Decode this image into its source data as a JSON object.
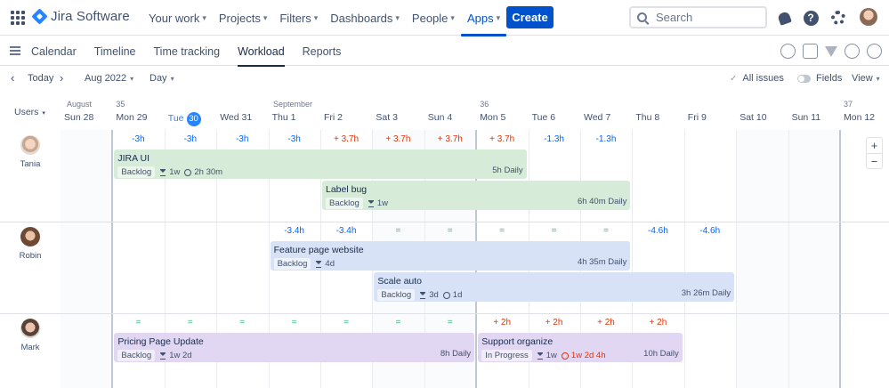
{
  "app": {
    "logo_text": "Jira Software"
  },
  "nav": [
    {
      "label": "Your work",
      "chevron": true,
      "active": false
    },
    {
      "label": "Projects",
      "chevron": true,
      "active": false
    },
    {
      "label": "Filters",
      "chevron": true,
      "active": false
    },
    {
      "label": "Dashboards",
      "chevron": true,
      "active": false
    },
    {
      "label": "People",
      "chevron": true,
      "active": false
    },
    {
      "label": "Apps",
      "chevron": true,
      "active": true
    }
  ],
  "create_label": "Create",
  "search": {
    "placeholder": "Search"
  },
  "tabs": [
    {
      "label": "Calendar",
      "active": false
    },
    {
      "label": "Timeline",
      "active": false
    },
    {
      "label": "Time tracking",
      "active": false
    },
    {
      "label": "Workload",
      "active": true
    },
    {
      "label": "Reports",
      "active": false
    }
  ],
  "toolbar": {
    "today": "Today",
    "month": "Aug 2022",
    "view_mode": "Day",
    "all_issues": "All issues",
    "fields": "Fields",
    "view": "View"
  },
  "calendar": {
    "users_label": "Users",
    "month_labels": {
      "aug": "August",
      "sep": "September"
    },
    "days": [
      {
        "label": "Sun 28",
        "week": "",
        "today": false
      },
      {
        "label": "Mon 29",
        "week": "35",
        "today": false
      },
      {
        "label": "Tue",
        "week": "",
        "today": true,
        "day_num": "30"
      },
      {
        "label": "Wed 31",
        "week": "",
        "today": false
      },
      {
        "label": "Thu 1",
        "week": "",
        "today": false
      },
      {
        "label": "Fri 2",
        "week": "",
        "today": false
      },
      {
        "label": "Sat 3",
        "week": "",
        "today": false
      },
      {
        "label": "Sun 4",
        "week": "",
        "today": false
      },
      {
        "label": "Mon 5",
        "week": "36",
        "today": false
      },
      {
        "label": "Tue 6",
        "week": "",
        "today": false
      },
      {
        "label": "Wed 7",
        "week": "",
        "today": false
      },
      {
        "label": "Thu 8",
        "week": "",
        "today": false
      },
      {
        "label": "Fri 9",
        "week": "",
        "today": false
      },
      {
        "label": "Sat 10",
        "week": "",
        "today": false
      },
      {
        "label": "Sun 11",
        "week": "",
        "today": false
      },
      {
        "label": "Mon 12",
        "week": "37",
        "today": false
      }
    ]
  },
  "users": [
    {
      "name": "Tania",
      "deltas": [
        "-3h",
        "-3h",
        "-3h",
        "-3h",
        "+ 3.7h",
        "+ 3.7h",
        "+ 3.7h",
        "+ 3.7h",
        "-1.3h",
        "-1.3h"
      ],
      "delta_types": [
        "neg",
        "neg",
        "neg",
        "neg",
        "pos",
        "pos",
        "pos",
        "pos",
        "neg",
        "neg"
      ],
      "delta_start": 1,
      "tasks": [
        {
          "title": "JIRA UI",
          "status": "Backlog",
          "estimate": "1w",
          "logged": "2h 30m",
          "daily": "5h Daily",
          "color": "green",
          "start": 1,
          "span": 8,
          "lane": 0
        },
        {
          "title": "Label bug",
          "status": "Backlog",
          "estimate": "1w",
          "logged": "",
          "daily": "6h 40m Daily",
          "color": "green",
          "start": 5,
          "span": 6,
          "lane": 1
        }
      ]
    },
    {
      "name": "Robin",
      "deltas": [
        "-3.4h",
        "-3.4h",
        "=",
        "=",
        "=",
        "=",
        "=",
        "-4.6h",
        "-4.6h"
      ],
      "delta_types": [
        "neg",
        "neg",
        "eq",
        "eq",
        "eq",
        "eq",
        "eq",
        "neg",
        "neg"
      ],
      "delta_start": 4,
      "tasks": [
        {
          "title": "Feature page website",
          "status": "Backlog",
          "estimate": "4d",
          "logged": "",
          "daily": "4h 35m Daily",
          "color": "blue",
          "start": 4,
          "span": 7,
          "lane": 0
        },
        {
          "title": "Scale auto",
          "status": "Backlog",
          "estimate": "3d",
          "logged": "1d",
          "daily": "3h 26m Daily",
          "color": "blue",
          "start": 6,
          "span": 7,
          "lane": 1
        }
      ]
    },
    {
      "name": "Mark",
      "deltas": [
        "=",
        "=",
        "=",
        "=",
        "=",
        "=",
        "=",
        "+ 2h",
        "+ 2h",
        "+ 2h",
        "+ 2h"
      ],
      "delta_types": [
        "eq",
        "eq",
        "eq",
        "eq",
        "eq",
        "eq",
        "eq",
        "pos",
        "pos",
        "pos",
        "pos"
      ],
      "delta_start": 1,
      "tasks": [
        {
          "title": "Pricing Page Update",
          "status": "Backlog",
          "estimate": "1w 2d",
          "logged": "",
          "daily": "8h Daily",
          "color": "purple",
          "start": 1,
          "span": 7,
          "lane": 0
        },
        {
          "title": "Support organize",
          "status": "In Progress",
          "estimate": "1w",
          "logged": "1w 2d 4h",
          "logged_over": true,
          "daily": "10h Daily",
          "color": "purple",
          "start": 8,
          "span": 4,
          "lane": 0
        }
      ]
    }
  ],
  "icons": {
    "apps_grid": "apps-grid-icon",
    "notifications": "bell-icon",
    "help": "help-icon",
    "settings": "gear-icon"
  },
  "colors": {
    "brand": "#0052cc",
    "today": "#2684ff",
    "negative": "#0065ff",
    "positive": "#de350b",
    "equal": "#36b37e",
    "task_green": "#d6ecd8",
    "task_blue": "#d8e2f6",
    "task_purple": "#e1d7f2"
  }
}
